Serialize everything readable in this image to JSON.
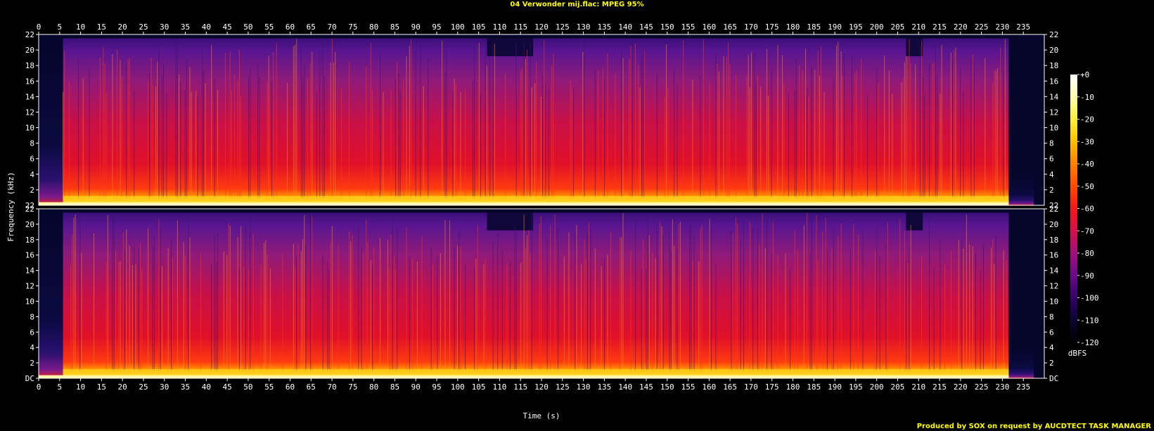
{
  "header": {
    "title": "04 Verwonder mij.flac: MPEG 95%"
  },
  "footer": {
    "text": "Produced by SOX on request by AUCDTECT TASK MANAGER"
  },
  "chart_data": {
    "type": "heatmap",
    "title": "04 Verwonder mij.flac: MPEG 95%",
    "xlabel": "Time (s)",
    "ylabel": "Frequency (kHz)",
    "xlim": [
      0,
      240
    ],
    "x_ticks": [
      0,
      5,
      10,
      15,
      20,
      25,
      30,
      35,
      40,
      45,
      50,
      55,
      60,
      65,
      70,
      75,
      80,
      85,
      90,
      95,
      100,
      105,
      110,
      115,
      120,
      125,
      130,
      135,
      140,
      145,
      150,
      155,
      160,
      165,
      170,
      175,
      180,
      185,
      190,
      195,
      200,
      205,
      210,
      215,
      220,
      225,
      230,
      235
    ],
    "ylim_khz": [
      0,
      22
    ],
    "y_tick_labels": [
      "DC",
      "2",
      "4",
      "6",
      "8",
      "10",
      "12",
      "14",
      "16",
      "18",
      "20",
      "22"
    ],
    "y_tick_values": [
      0,
      2,
      4,
      6,
      8,
      10,
      12,
      14,
      16,
      18,
      20,
      22
    ],
    "channels": 2,
    "audio_start_s": 5.8,
    "audio_end_s": 231.5,
    "lowpass_khz": 21.5,
    "quiet_segments": [
      {
        "start_s": 107,
        "end_s": 118
      },
      {
        "start_s": 207,
        "end_s": 211
      }
    ],
    "colorbar": {
      "label": "dBFS",
      "tick_labels": [
        "+0",
        "-10",
        "-20",
        "-30",
        "-40",
        "-50",
        "-60",
        "-70",
        "-80",
        "-90",
        "-100",
        "-110",
        "-120"
      ],
      "tick_values": [
        0,
        -10,
        -20,
        -30,
        -40,
        -50,
        -60,
        -70,
        -80,
        -90,
        -100,
        -110,
        -120
      ],
      "colors": [
        "#000000",
        "#0a0533",
        "#330066",
        "#6a0a8a",
        "#a0107a",
        "#d4104a",
        "#f01818",
        "#ff4a00",
        "#ff8000",
        "#ffbf00",
        "#ffee40",
        "#ffffb0",
        "#ffffff"
      ]
    }
  }
}
